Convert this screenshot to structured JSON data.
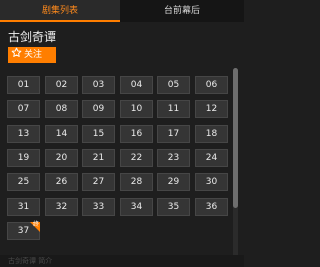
{
  "tabs": [
    {
      "label": "剧集列表",
      "active": true
    },
    {
      "label": "台前幕后",
      "active": false
    }
  ],
  "show": {
    "title": "古剑奇谭",
    "follow_label": "关注"
  },
  "episodes": [
    "01",
    "02",
    "03",
    "04",
    "05",
    "06",
    "07",
    "08",
    "09",
    "10",
    "11",
    "12",
    "13",
    "14",
    "15",
    "16",
    "17",
    "18",
    "19",
    "20",
    "21",
    "22",
    "23",
    "24",
    "25",
    "26",
    "27",
    "28",
    "29",
    "30",
    "31",
    "32",
    "33",
    "34",
    "35",
    "36",
    "37"
  ],
  "latest_badge": "终",
  "footer_text": "古剑奇谭 简介",
  "colors": {
    "accent": "#ff7e00",
    "background": "#1e1e1e",
    "tile": "#353535"
  }
}
